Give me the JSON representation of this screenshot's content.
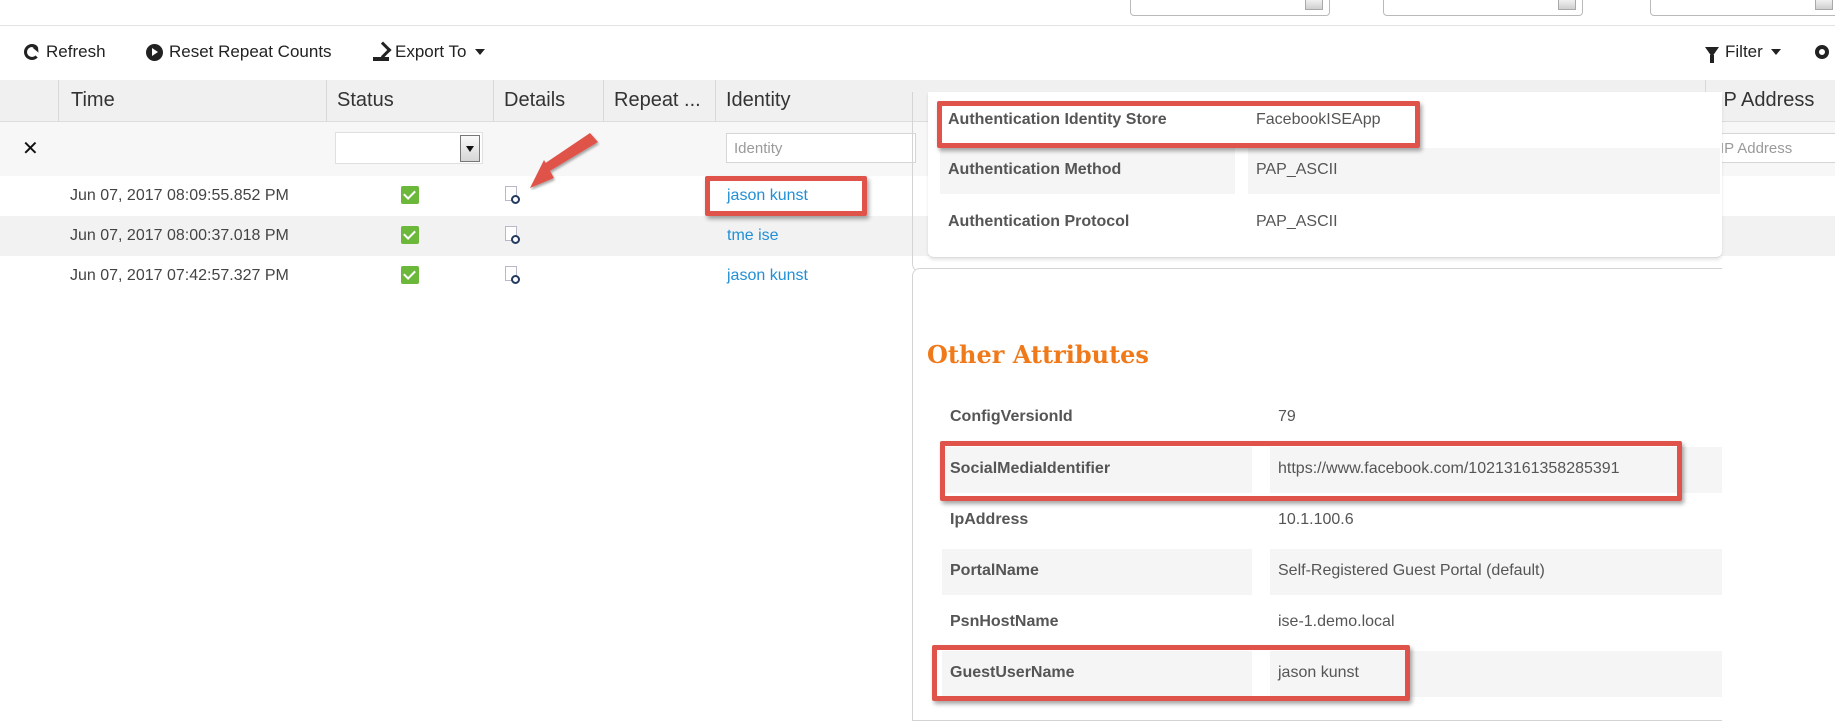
{
  "toolbar": {
    "refresh_label": "Refresh",
    "reset_label": "Reset Repeat Counts",
    "export_label": "Export To",
    "filter_label": "Filter"
  },
  "grid": {
    "columns": [
      "Time",
      "Status",
      "Details",
      "Repeat ...",
      "Identity",
      "IP Address"
    ],
    "filters": {
      "identity_placeholder": "Identity",
      "ip_placeholder": "IP Address"
    },
    "rows": [
      {
        "time": "Jun 07, 2017 08:09:55.852 PM",
        "identity": "jason kunst"
      },
      {
        "time": "Jun 07, 2017 08:00:37.018 PM",
        "identity": "tme ise"
      },
      {
        "time": "Jun 07, 2017 07:42:57.327 PM",
        "identity": "jason kunst"
      }
    ]
  },
  "auth_details": [
    {
      "key": "Authentication Identity Store",
      "value": "FacebookISEApp"
    },
    {
      "key": "Authentication Method",
      "value": "PAP_ASCII"
    },
    {
      "key": "Authentication Protocol",
      "value": "PAP_ASCII"
    }
  ],
  "other_attributes": {
    "title": "Other Attributes",
    "items": [
      {
        "key": "ConfigVersionId",
        "value": "79"
      },
      {
        "key": "SocialMediaIdentifier",
        "value": "https://www.facebook.com/10213161358285391"
      },
      {
        "key": "IpAddress",
        "value": "10.1.100.6"
      },
      {
        "key": "PortalName",
        "value": "Self-Registered Guest Portal (default)"
      },
      {
        "key": "PsnHostName",
        "value": "ise-1.demo.local"
      },
      {
        "key": "GuestUserName",
        "value": "jason kunst"
      }
    ]
  },
  "colors": {
    "highlight": "#e0534a",
    "link": "#1f8fd6",
    "section_title": "#f07a1a",
    "status_ok": "#6bb83a"
  }
}
